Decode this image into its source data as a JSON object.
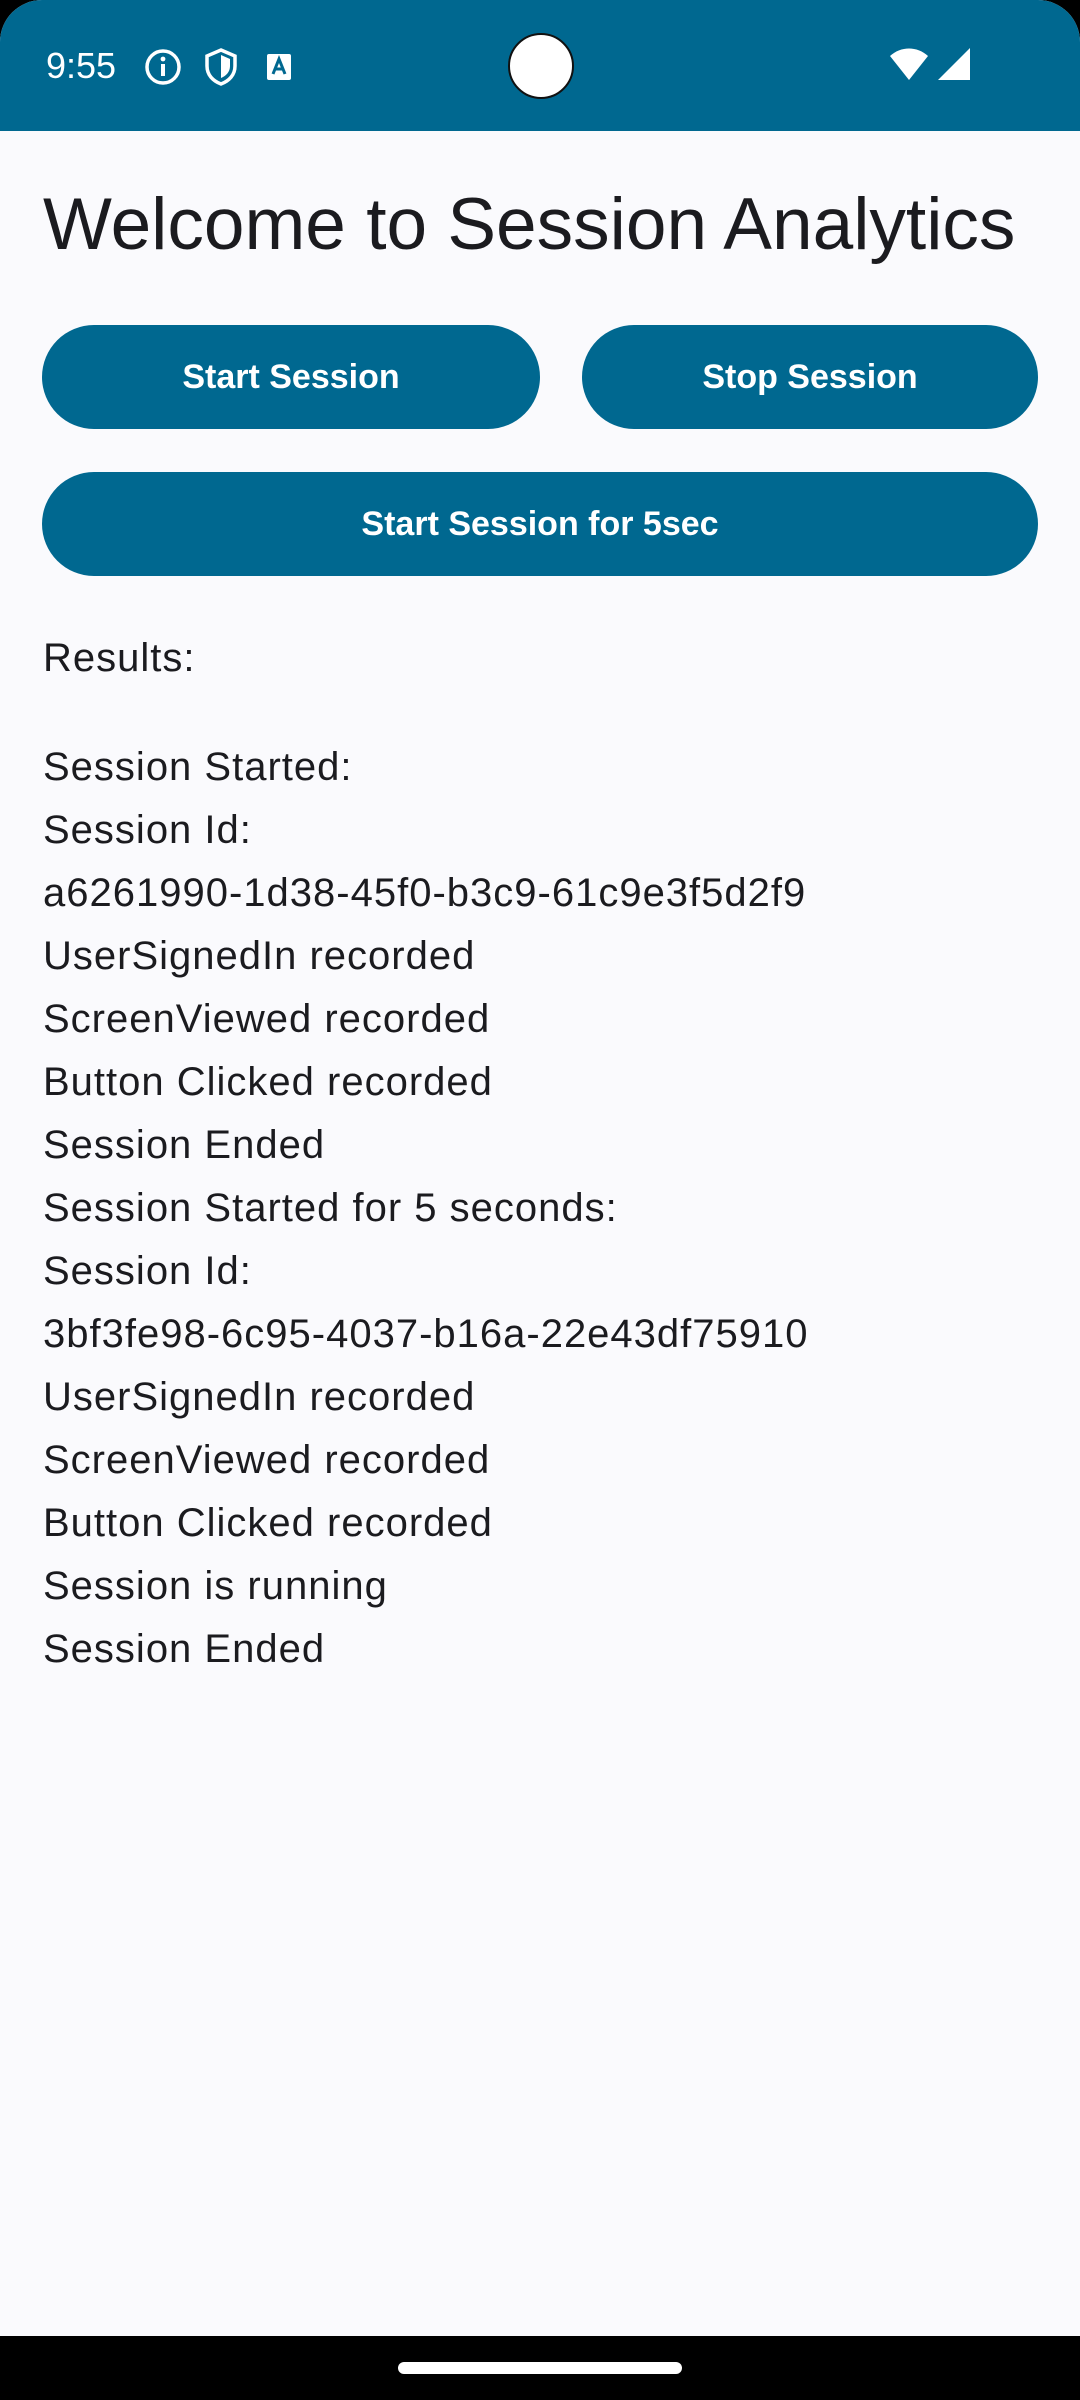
{
  "status_bar": {
    "time": "9:55",
    "icons": [
      "info-icon",
      "shield-icon",
      "text-a-icon",
      "wifi-icon",
      "cellular-signal-icon"
    ],
    "color": "#006890"
  },
  "app": {
    "title": "Welcome to Session Analytics",
    "accent_color": "#006890"
  },
  "buttons": {
    "start_session": "Start Session",
    "stop_session": "Stop Session",
    "start_session_5sec": "Start Session for 5sec"
  },
  "results": {
    "label": "Results:",
    "lines": [
      "Session Started:",
      "Session Id:",
      "a6261990-1d38-45f0-b3c9-61c9e3f5d2f9",
      "UserSignedIn recorded",
      "ScreenViewed recorded",
      "Button Clicked recorded",
      "Session Ended",
      "Session Started for 5 seconds:",
      "Session Id:",
      "3bf3fe98-6c95-4037-b16a-22e43df75910",
      "UserSignedIn recorded",
      "ScreenViewed recorded",
      "Button Clicked recorded",
      "Session is running",
      "Session Ended"
    ]
  }
}
